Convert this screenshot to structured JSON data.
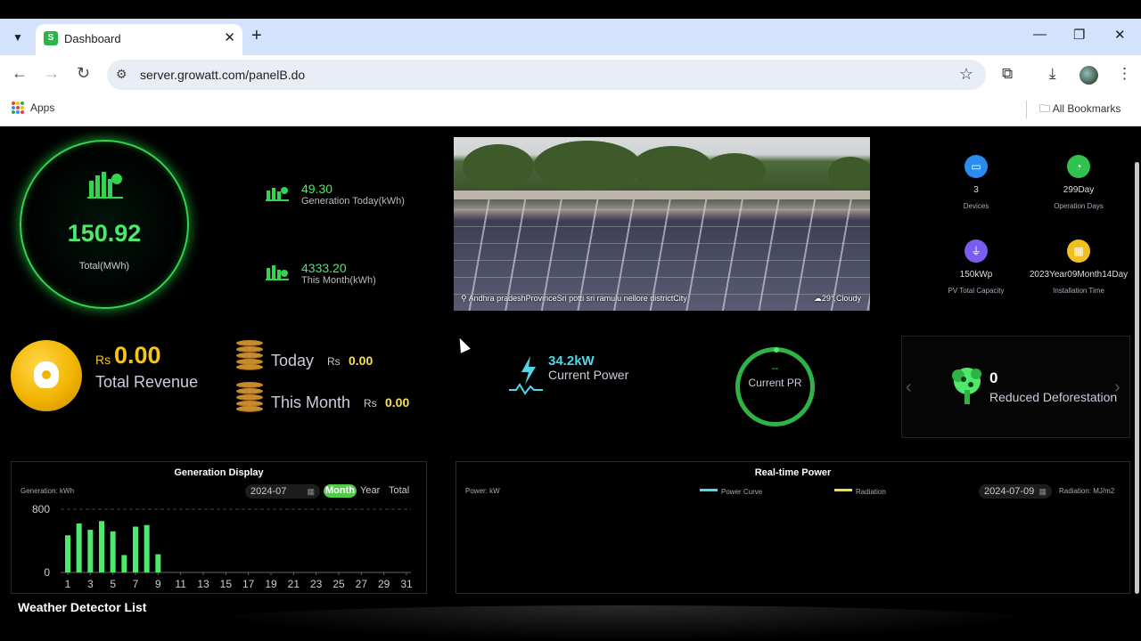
{
  "browser": {
    "tab_title": "Dashboard",
    "tab_favicon": "S",
    "url": "server.growatt.com/panelB.do",
    "bookmarks_apps": "Apps",
    "bookmarks_all": "All Bookmarks"
  },
  "total": {
    "value": "150.92",
    "label": "Total(MWh)"
  },
  "gen_today": {
    "value": "49.30",
    "label": "Generation Today(kWh)"
  },
  "gen_month": {
    "value": "4333.20",
    "label": "This Month(kWh)"
  },
  "photo": {
    "location": "Andhra pradeshProvinceSri potti sri ramulu nellore districtCity",
    "weather": "29°,Cloudy"
  },
  "info": [
    {
      "value": "3",
      "label": "Devices",
      "color": "#2b8cf0",
      "icon": "device-icon"
    },
    {
      "value": "299Day",
      "label": "Operation Days",
      "color": "#2fc24f",
      "icon": "clock-icon"
    },
    {
      "value": "150kWp",
      "label": "PV Total Capacity",
      "color": "#7b5cf0",
      "icon": "tower-icon"
    },
    {
      "value": "2023Year09Month14Day",
      "label": "Installation Time",
      "color": "#f0c020",
      "icon": "calendar-icon"
    }
  ],
  "revenue": {
    "currency": "Rs",
    "value": "0.00",
    "label": "Total Revenue"
  },
  "revenue_today": {
    "label": "Today",
    "currency": "Rs",
    "value": "0.00"
  },
  "revenue_month": {
    "label": "This Month",
    "currency": "Rs",
    "value": "0.00"
  },
  "current_power": {
    "value": "34.2kW",
    "label": "Current Power"
  },
  "current_pr": {
    "value": "--",
    "label": "Current PR"
  },
  "deforestation": {
    "value": "0",
    "label": "Reduced Deforestation"
  },
  "generation_display": {
    "title": "Generation Display",
    "unit_label": "Generation:  kWh",
    "date": "2024-07",
    "segments": [
      "Month",
      "Year",
      "Total"
    ],
    "active_segment": "Month"
  },
  "realtime_power": {
    "title": "Real-time Power",
    "unit_label": "Power:  kW",
    "legend_power": "Power Curve",
    "legend_radiation": "Radiation",
    "date": "2024-07-09",
    "radiation_unit": "Radiation:  MJ/m2",
    "colors": {
      "power": "#4fd8e8",
      "radiation": "#f0e040"
    }
  },
  "weather_title": "Weather Detector List",
  "chart_data": {
    "type": "bar",
    "categories": [
      "1",
      "2",
      "3",
      "4",
      "5",
      "6",
      "7",
      "8",
      "9",
      "10",
      "11",
      "12",
      "13",
      "14",
      "15",
      "16",
      "17",
      "18",
      "19",
      "20",
      "21",
      "22",
      "23",
      "24",
      "25",
      "26",
      "27",
      "28",
      "29",
      "30",
      "31"
    ],
    "tick_labels": [
      "1",
      "3",
      "5",
      "7",
      "9",
      "11",
      "13",
      "15",
      "17",
      "19",
      "21",
      "23",
      "25",
      "27",
      "29",
      "31"
    ],
    "values": [
      470,
      620,
      540,
      650,
      520,
      220,
      580,
      600,
      230,
      0,
      0,
      0,
      0,
      0,
      0,
      0,
      0,
      0,
      0,
      0,
      0,
      0,
      0,
      0,
      0,
      0,
      0,
      0,
      0,
      0,
      0
    ],
    "ylim": [
      0,
      800
    ],
    "yticks": [
      "800",
      "0"
    ],
    "color": "#4ee86b"
  }
}
